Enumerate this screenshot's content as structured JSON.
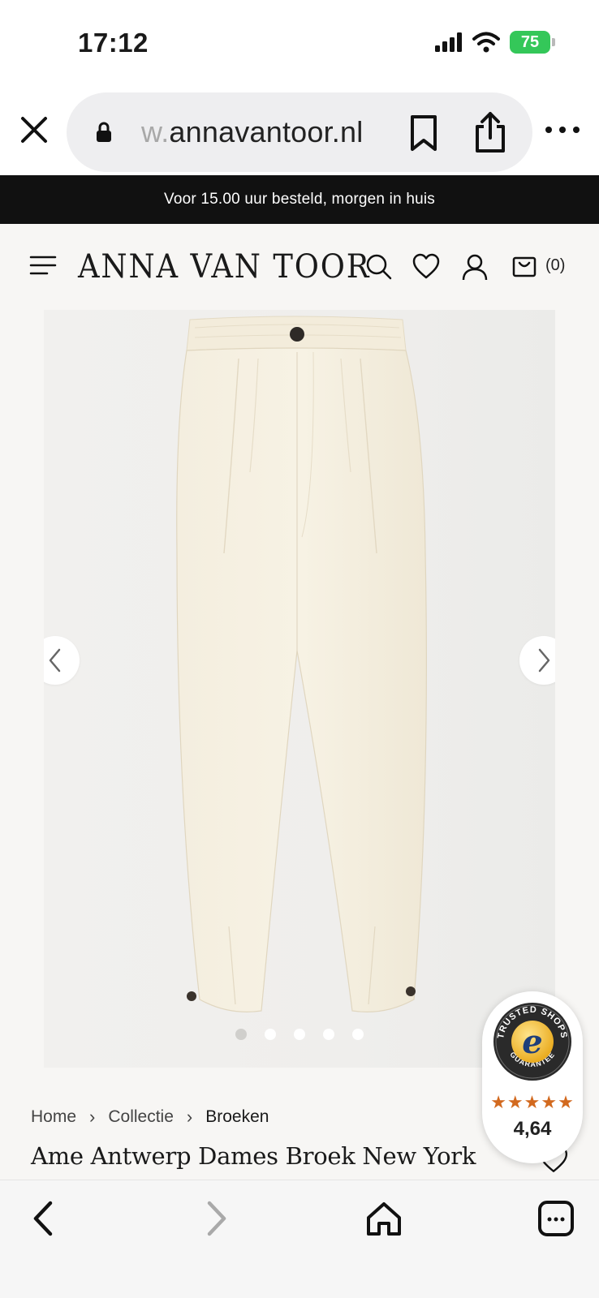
{
  "status_bar": {
    "time": "17:12",
    "battery": "75",
    "icons": [
      "signal-icon",
      "wifi-icon",
      "battery-charging-icon"
    ]
  },
  "browser": {
    "url_faded": "w.",
    "url_main": "annavantoor.nl",
    "icons": [
      "close-icon",
      "lock-icon",
      "bookmark-icon",
      "share-icon",
      "more-icon"
    ]
  },
  "promo": {
    "text": "Voor 15.00 uur besteld, morgen in huis"
  },
  "site_header": {
    "logo": "ANNA VAN TOOR",
    "cart_count": "(0)",
    "icons": [
      "menu-icon",
      "search-icon",
      "heart-icon",
      "user-icon",
      "cart-icon"
    ]
  },
  "gallery": {
    "image_count": 5,
    "active_index": 0,
    "icons": [
      "chevron-left-icon",
      "chevron-right-icon"
    ]
  },
  "breadcrumb": {
    "items": [
      "Home",
      "Collectie",
      "Broeken"
    ]
  },
  "product": {
    "title": "Ame Antwerp Dames Broek New York"
  },
  "trusted_shops": {
    "seal_text_top": "TRUSTED SHOPS",
    "seal_text_bottom": "GUARANTEE",
    "seal_letter": "e",
    "stars": "★★★★★",
    "rating": "4,64"
  },
  "toolbar": {
    "icons": [
      "back-icon",
      "forward-icon",
      "home-icon",
      "tabs-icon"
    ]
  },
  "colors": {
    "promo_bg": "#111111",
    "page_bg": "#f7f6f4",
    "battery": "#34c759",
    "star": "#d2691e"
  }
}
